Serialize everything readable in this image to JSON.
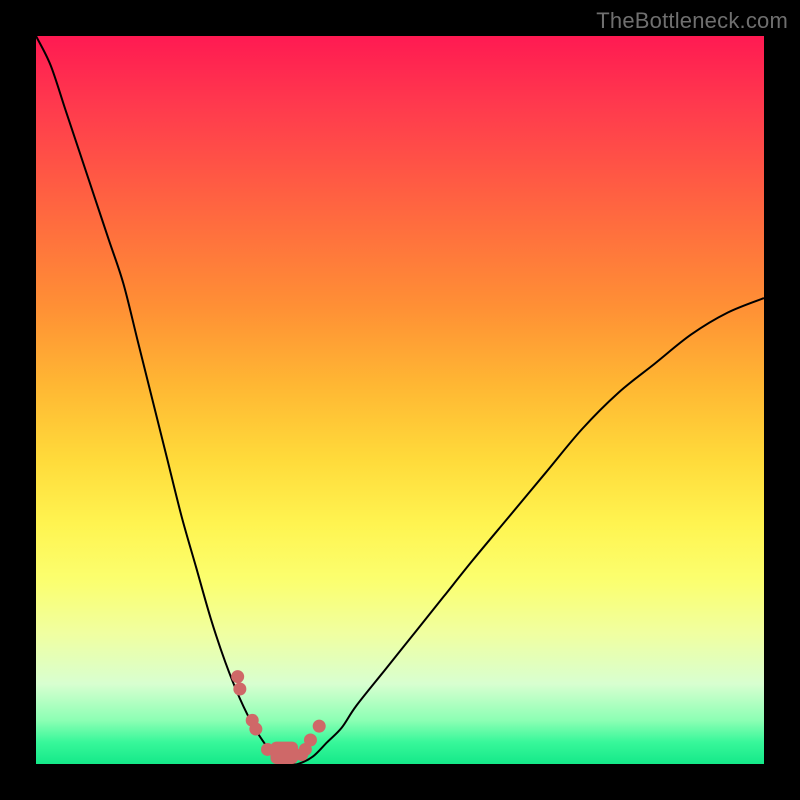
{
  "watermark": "TheBottleneck.com",
  "colors": {
    "frame_bg": "#000000",
    "curve_stroke": "#000000",
    "marker_fill": "#cf6868",
    "watermark_text": "#6f6f6f"
  },
  "chart_data": {
    "type": "line",
    "title": "",
    "xlabel": "",
    "ylabel": "",
    "xlim": [
      0,
      100
    ],
    "ylim": [
      0,
      100
    ],
    "x": [
      0,
      2,
      4,
      6,
      8,
      10,
      12,
      14,
      16,
      18,
      20,
      22,
      24,
      26,
      28,
      30,
      32,
      33,
      34,
      35,
      36,
      38,
      40,
      42,
      44,
      48,
      52,
      56,
      60,
      65,
      70,
      75,
      80,
      85,
      90,
      95,
      100
    ],
    "series": [
      {
        "name": "bottleneck-curve",
        "values": [
          100,
          96,
          90,
          84,
          78,
          72,
          66,
          58,
          50,
          42,
          34,
          27,
          20,
          14,
          9,
          5,
          2,
          1,
          0,
          0,
          0,
          1,
          3,
          5,
          8,
          13,
          18,
          23,
          28,
          34,
          40,
          46,
          51,
          55,
          59,
          62,
          64
        ]
      }
    ],
    "markers": {
      "comment": "points highlighted along the curve near the trough",
      "x": [
        27.7,
        28.0,
        29.7,
        30.2,
        31.8,
        36.5,
        37.0,
        37.7,
        38.9
      ],
      "y": [
        12.0,
        10.3,
        6.0,
        4.8,
        2.0,
        1.3,
        2.0,
        3.3,
        5.2
      ]
    },
    "trough_bar": {
      "x_start": 32.2,
      "x_end": 36.0,
      "y": 0.0,
      "height_pct": 1.7
    },
    "gradient_stops": [
      {
        "pos": 0.0,
        "color": "#ff1a52"
      },
      {
        "pos": 0.25,
        "color": "#ff6a3f"
      },
      {
        "pos": 0.5,
        "color": "#ffc536"
      },
      {
        "pos": 0.7,
        "color": "#fff95d"
      },
      {
        "pos": 0.9,
        "color": "#c8ffc8"
      },
      {
        "pos": 1.0,
        "color": "#14e989"
      }
    ]
  }
}
